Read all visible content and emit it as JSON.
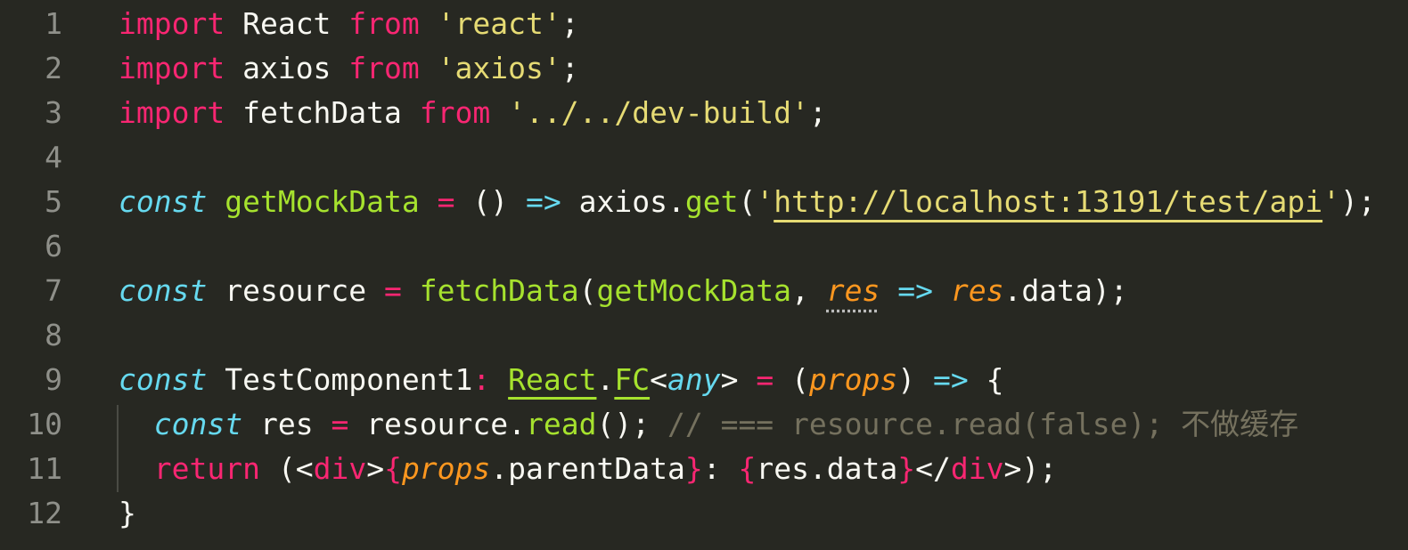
{
  "editor": {
    "theme": {
      "background": "#272822",
      "gutter": "#8f908a"
    },
    "lines": [
      {
        "number": "1",
        "tokens": [
          {
            "t": "import",
            "c": "kw"
          },
          {
            "t": " React ",
            "c": "pl"
          },
          {
            "t": "from",
            "c": "kw"
          },
          {
            "t": " ",
            "c": "pl"
          },
          {
            "t": "'react'",
            "c": "st"
          },
          {
            "t": ";",
            "c": "pl"
          }
        ]
      },
      {
        "number": "2",
        "tokens": [
          {
            "t": "import",
            "c": "kw"
          },
          {
            "t": " axios ",
            "c": "pl"
          },
          {
            "t": "from",
            "c": "kw"
          },
          {
            "t": " ",
            "c": "pl"
          },
          {
            "t": "'axios'",
            "c": "st"
          },
          {
            "t": ";",
            "c": "pl"
          }
        ]
      },
      {
        "number": "3",
        "tokens": [
          {
            "t": "import",
            "c": "kw"
          },
          {
            "t": " fetchData ",
            "c": "pl"
          },
          {
            "t": "from",
            "c": "kw"
          },
          {
            "t": " ",
            "c": "pl"
          },
          {
            "t": "'../../dev-build'",
            "c": "st"
          },
          {
            "t": ";",
            "c": "pl"
          }
        ]
      },
      {
        "number": "4",
        "tokens": []
      },
      {
        "number": "5",
        "tokens": [
          {
            "t": "const",
            "c": "it"
          },
          {
            "t": " ",
            "c": "pl"
          },
          {
            "t": "getMockData",
            "c": "fn"
          },
          {
            "t": " ",
            "c": "pl"
          },
          {
            "t": "=",
            "c": "op"
          },
          {
            "t": " () ",
            "c": "pl"
          },
          {
            "t": "=>",
            "c": "ar"
          },
          {
            "t": " axios.",
            "c": "pl"
          },
          {
            "t": "get",
            "c": "fn"
          },
          {
            "t": "(",
            "c": "pl"
          },
          {
            "t": "'",
            "c": "st"
          },
          {
            "t": "http://localhost:13191/test/api",
            "c": "url"
          },
          {
            "t": "'",
            "c": "st"
          },
          {
            "t": ");",
            "c": "pl"
          }
        ]
      },
      {
        "number": "6",
        "tokens": []
      },
      {
        "number": "7",
        "tokens": [
          {
            "t": "const",
            "c": "it"
          },
          {
            "t": " resource ",
            "c": "pl"
          },
          {
            "t": "=",
            "c": "op"
          },
          {
            "t": " ",
            "c": "pl"
          },
          {
            "t": "fetchData",
            "c": "fn"
          },
          {
            "t": "(",
            "c": "pl"
          },
          {
            "t": "getMockData",
            "c": "fn"
          },
          {
            "t": ", ",
            "c": "pl"
          },
          {
            "t": "res",
            "c": "hint"
          },
          {
            "t": " ",
            "c": "pl"
          },
          {
            "t": "=>",
            "c": "ar"
          },
          {
            "t": " ",
            "c": "pl"
          },
          {
            "t": "res",
            "c": "pa"
          },
          {
            "t": ".data);",
            "c": "pl"
          }
        ]
      },
      {
        "number": "8",
        "tokens": []
      },
      {
        "number": "9",
        "tokens": [
          {
            "t": "const",
            "c": "it"
          },
          {
            "t": " TestComponent1",
            "c": "pl"
          },
          {
            "t": ":",
            "c": "op"
          },
          {
            "t": " ",
            "c": "pl"
          },
          {
            "t": "React",
            "c": "ty"
          },
          {
            "t": ".",
            "c": "pl"
          },
          {
            "t": "FC",
            "c": "ty"
          },
          {
            "t": "<",
            "c": "pl"
          },
          {
            "t": "any",
            "c": "it"
          },
          {
            "t": "> ",
            "c": "pl"
          },
          {
            "t": "=",
            "c": "op"
          },
          {
            "t": " (",
            "c": "pl"
          },
          {
            "t": "props",
            "c": "pa"
          },
          {
            "t": ") ",
            "c": "pl"
          },
          {
            "t": "=>",
            "c": "ar"
          },
          {
            "t": " {",
            "c": "pl"
          }
        ]
      },
      {
        "number": "10",
        "tokens": [
          {
            "t": "  ",
            "c": "pl"
          },
          {
            "t": "const",
            "c": "it"
          },
          {
            "t": " res ",
            "c": "pl"
          },
          {
            "t": "=",
            "c": "op"
          },
          {
            "t": " resource.",
            "c": "pl"
          },
          {
            "t": "read",
            "c": "fn"
          },
          {
            "t": "(); ",
            "c": "pl"
          },
          {
            "t": "// === resource.read(false); 不做缓存",
            "c": "cm"
          }
        ]
      },
      {
        "number": "11",
        "tokens": [
          {
            "t": "  ",
            "c": "pl"
          },
          {
            "t": "return",
            "c": "kw"
          },
          {
            "t": " (<",
            "c": "pl"
          },
          {
            "t": "div",
            "c": "tg"
          },
          {
            "t": ">",
            "c": "pl"
          },
          {
            "t": "{",
            "c": "kw"
          },
          {
            "t": "props",
            "c": "pa"
          },
          {
            "t": ".parentData",
            "c": "pl"
          },
          {
            "t": "}",
            "c": "kw"
          },
          {
            "t": ": ",
            "c": "pl"
          },
          {
            "t": "{",
            "c": "kw"
          },
          {
            "t": "res.data",
            "c": "pl"
          },
          {
            "t": "}",
            "c": "kw"
          },
          {
            "t": "</",
            "c": "pl"
          },
          {
            "t": "div",
            "c": "tg"
          },
          {
            "t": ">);",
            "c": "pl"
          }
        ]
      },
      {
        "number": "12",
        "tokens": [
          {
            "t": "}",
            "c": "pl"
          }
        ]
      }
    ]
  }
}
